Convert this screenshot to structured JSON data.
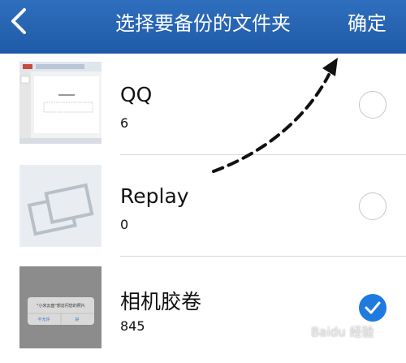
{
  "navbar": {
    "title": "选择要备份的文件夹",
    "confirm_label": "确定"
  },
  "folders": [
    {
      "name": "QQ",
      "count": "6",
      "selected": false,
      "thumb_icon": "document-screenshot-thumb"
    },
    {
      "name": "Replay",
      "count": "0",
      "selected": false,
      "thumb_icon": "photo-placeholder-thumb"
    },
    {
      "name": "相机胶卷",
      "count": "845",
      "selected": true,
      "thumb_icon": "dialog-screenshot-thumb"
    }
  ],
  "thumb_text": {
    "camera_dialog_title": "\"小米云盘\"想访问您的照片",
    "camera_dialog_left": "不允许",
    "camera_dialog_right": "好"
  },
  "watermark": "Baidu 经验",
  "colors": {
    "navbar": "#1f5aa8",
    "accent": "#1f7ae0",
    "arrow": "#111111"
  }
}
